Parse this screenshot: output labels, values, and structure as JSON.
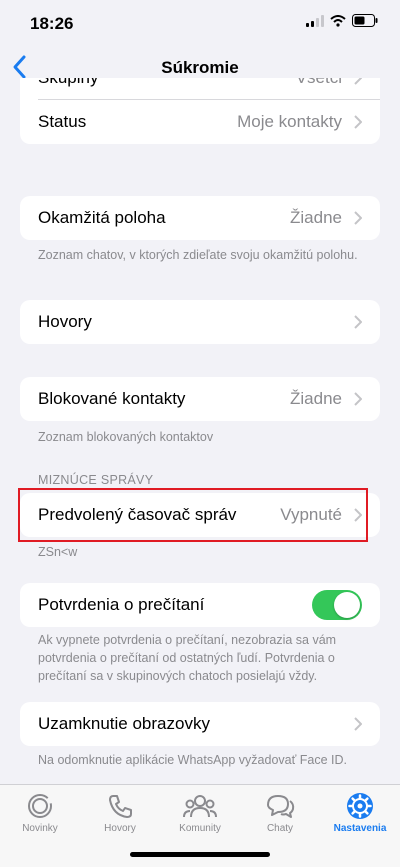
{
  "status": {
    "time": "18:26"
  },
  "nav": {
    "title": "Súkromie"
  },
  "groups": {
    "top": [
      {
        "label": "Skupiny",
        "value": "Všetci"
      },
      {
        "label": "Status",
        "value": "Moje kontakty"
      }
    ],
    "live_location": {
      "label": "Okamžitá poloha",
      "value": "Žiadne",
      "note": "Zoznam chatov, v ktorých zdieľate svoju okamžitú polohu."
    },
    "calls": {
      "label": "Hovory"
    },
    "blocked": {
      "label": "Blokované kontakty",
      "value": "Žiadne",
      "note": "Zoznam blokovaných kontaktov"
    },
    "disappearing": {
      "header": "MIZNÚCE SPRÁVY",
      "label": "Predvolený časovač správ",
      "value": "Vypnuté",
      "note": "ZSn<w"
    },
    "read_receipts": {
      "label": "Potvrdenia o prečítaní",
      "enabled": true,
      "note": "Ak vypnete potvrdenia o prečítaní, nezobrazia sa vám potvrdenia o prečítaní od ostatných ľudí. Potvrdenia o prečítaní sa v skupinových chatoch posielajú vždy."
    },
    "screen_lock": {
      "label": "Uzamknutie obrazovky",
      "note": "Na odomknutie aplikácie WhatsApp vyžadovať Face ID."
    }
  },
  "tabs": [
    {
      "label": "Novinky",
      "icon": "updates-icon",
      "active": false
    },
    {
      "label": "Hovory",
      "icon": "phone-icon",
      "active": false
    },
    {
      "label": "Komunity",
      "icon": "communities-icon",
      "active": false
    },
    {
      "label": "Chaty",
      "icon": "chats-icon",
      "active": false
    },
    {
      "label": "Nastavenia",
      "icon": "settings-icon",
      "active": true
    }
  ],
  "colors": {
    "accent": "#1a7cf0",
    "toggle_on": "#34c759",
    "highlight": "#e01b24",
    "background": "#f2f2f7"
  }
}
